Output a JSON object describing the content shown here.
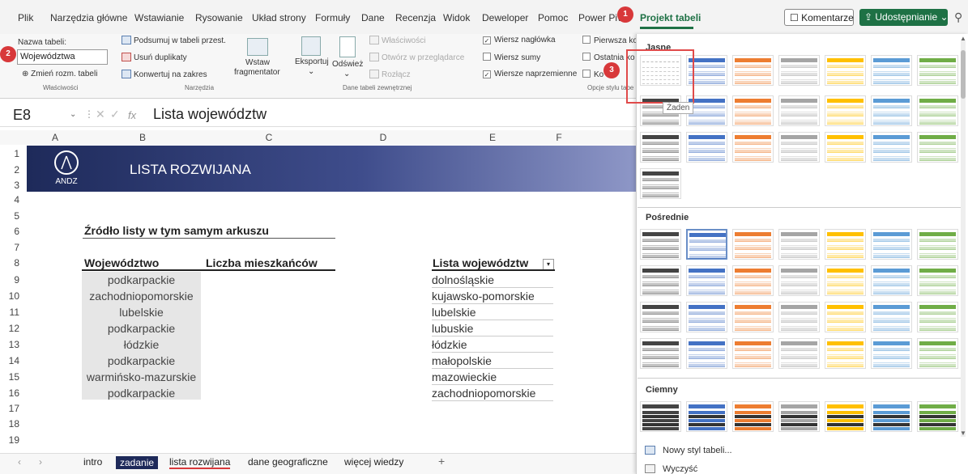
{
  "menu": {
    "tabs": [
      "Plik",
      "Narzędzia główne",
      "Wstawianie",
      "Rysowanie",
      "Układ strony",
      "Formuły",
      "Dane",
      "Recenzja",
      "Widok",
      "Deweloper",
      "Pomoc",
      "Power Pivot",
      "Projekt tabeli"
    ],
    "active_tab": "Projekt tabeli",
    "comments_label": "Komentarze",
    "share_label": "Udostępnianie"
  },
  "ribbon": {
    "table_name_label": "Nazwa tabeli:",
    "table_name_value": "Województwa",
    "resize_label": "Zmień rozm. tabeli",
    "group_properties": "Właściwości",
    "summarize_label": "Podsumuj w tabeli przest.",
    "remove_duplicates_label": "Usuń duplikaty",
    "convert_label": "Konwertuj na zakres",
    "insert_slicer_line1": "Wstaw",
    "insert_slicer_line2": "fragmentator",
    "group_tools": "Narzędzia",
    "export_label": "Eksportuj",
    "refresh_label": "Odśwież",
    "properties_label": "Właściwości",
    "open_browser_label": "Otwórz w przeglądarce",
    "unlink_label": "Rozłącz",
    "group_external": "Dane tabeli zewnętrznej",
    "header_row_label": "Wiersz nagłówka",
    "total_row_label": "Wiersz sumy",
    "banded_rows_label": "Wiersze naprzemienne",
    "first_col_label": "Pierwsza ko",
    "last_col_label": "Ostatnia ko",
    "banded_cols_label": "Ko",
    "group_style_options": "Opcje stylu tabe"
  },
  "formula_bar": {
    "cell_ref": "E8",
    "fx": "fx",
    "content": "Lista województw"
  },
  "columns": [
    "A",
    "B",
    "C",
    "D",
    "E",
    "F"
  ],
  "rows": [
    "1",
    "2",
    "3",
    "4",
    "5",
    "6",
    "7",
    "8",
    "9",
    "10",
    "11",
    "12",
    "13",
    "14",
    "15",
    "16",
    "17",
    "18",
    "19"
  ],
  "sheet": {
    "banner_title": "LISTA ROZWIJANA",
    "logo_text": "ANDZ",
    "source_title": "Źródło listy w tym samym arkuszu",
    "left_headers": [
      "Województwo",
      "Liczba mieszkańców"
    ],
    "left_values": [
      "podkarpackie",
      "zachodniopomorskie",
      "lubelskie",
      "podkarpackie",
      "łódzkie",
      "podkarpackie",
      "warmińsko-mazurskie",
      "podkarpackie"
    ],
    "right_header": "Lista województw",
    "right_values": [
      "dolnośląskie",
      "kujawsko-pomorskie",
      "lubelskie",
      "lubuskie",
      "łódzkie",
      "małopolskie",
      "mazowieckie",
      "zachodniopomorskie"
    ]
  },
  "sheet_tabs": [
    "intro",
    "zadanie",
    "lista rozwijana",
    "dane geograficzne",
    "więcej wiedzy",
    "+"
  ],
  "active_sheet": "lista rozwijana",
  "gallery": {
    "light_header": "Jasne",
    "medium_header": "Pośrednie",
    "dark_header": "Ciemny",
    "tooltip": "Żaden",
    "new_style_label": "Nowy styl tabeli...",
    "clear_label": "Wyczyść",
    "colors": [
      "#444444",
      "#4472c4",
      "#ed7d31",
      "#a5a5a5",
      "#ffc000",
      "#5b9bd5",
      "#70ad47"
    ]
  },
  "badges": [
    "1",
    "2",
    "3"
  ]
}
